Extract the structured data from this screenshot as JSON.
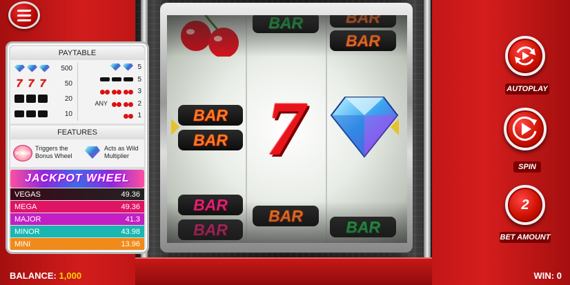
{
  "paytable": {
    "title": "PAYTABLE",
    "left_rows": [
      {
        "symbol": "diamond",
        "value": "500"
      },
      {
        "symbol": "seven",
        "value": "50"
      },
      {
        "symbol": "double-bar",
        "value": "20"
      },
      {
        "symbol": "single-bar",
        "value": "10"
      }
    ],
    "right_rows": [
      {
        "symbol": "diamond",
        "value": "5"
      },
      {
        "symbol": "bar-mix",
        "value": "5"
      },
      {
        "symbol": "cherry",
        "value": "3"
      },
      {
        "symbol": "cherry",
        "prefix": "ANY",
        "value": "2"
      },
      {
        "symbol": "cherry",
        "value": "1"
      }
    ]
  },
  "features": {
    "title": "FEATURES",
    "bonus_badge": "BONUS",
    "bonus_text": "Triggers the Bonus Wheel",
    "wild_text": "Acts as Wild Multiplier"
  },
  "jackpot": {
    "title": "JACKPOT WHEEL",
    "rows": [
      {
        "name": "VEGAS",
        "value": "49.36"
      },
      {
        "name": "MEGA",
        "value": "49.36"
      },
      {
        "name": "MAJOR",
        "value": "41.3"
      },
      {
        "name": "MINOR",
        "value": "43.98"
      },
      {
        "name": "MINI",
        "value": "13.96"
      }
    ]
  },
  "reels": {
    "reel1": [
      "cherry",
      "double-bar",
      "pink-double-bar"
    ],
    "reel2": [
      "green-bar",
      "seven",
      "orange-bar"
    ],
    "reel3": [
      "orange-double-bar",
      "diamond",
      "green-bar"
    ],
    "bar_text": "BAR",
    "seven_text": "7"
  },
  "controls": {
    "autoplay_label": "AUTOPLAY",
    "spin_label": "SPIN",
    "bet_label": "BET AMOUNT",
    "bet_value": "2"
  },
  "footer": {
    "balance_label": "BALANCE:",
    "balance_value": "1,000",
    "win_label": "WIN:",
    "win_value": "0"
  },
  "colors": {
    "brand_red": "#c81818",
    "balance_yellow": "#ffd200",
    "mega": "#e01464",
    "major": "#c21fc4",
    "minor": "#19b7b0",
    "mini": "#f08a1a"
  }
}
